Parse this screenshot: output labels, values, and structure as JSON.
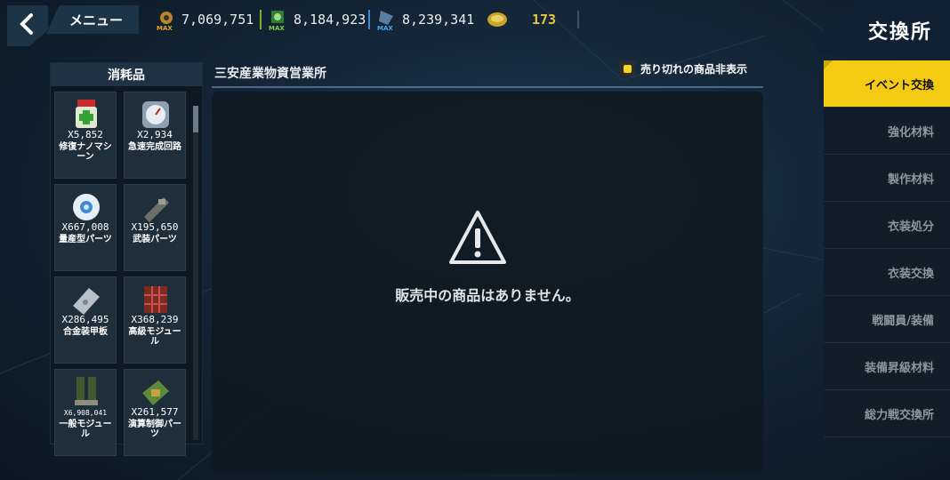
{
  "header": {
    "menu_label": "メニュー",
    "title": "交換所",
    "resources": [
      {
        "icon": "gear-max-icon",
        "value": "7,069,751",
        "badge": "MAX"
      },
      {
        "icon": "green-max-icon",
        "value": "8,184,923",
        "badge": "MAX"
      },
      {
        "icon": "blue-max-icon",
        "value": "8,239,341",
        "badge": "MAX"
      },
      {
        "icon": "gold-coin-icon",
        "value": "173"
      }
    ],
    "colors": {
      "accent": "#f4cb12"
    }
  },
  "inventory": {
    "heading": "消耗品",
    "items": [
      {
        "icon": "repair-nanomachine-icon",
        "count": "X5,852",
        "name": "修復ナノマシーン"
      },
      {
        "icon": "quick-circuit-icon",
        "count": "X2,934",
        "name": "急速完成回路"
      },
      {
        "icon": "mass-production-parts-icon",
        "count": "X667,008",
        "name": "量産型パーツ"
      },
      {
        "icon": "weapon-parts-icon",
        "count": "X195,650",
        "name": "武装パーツ"
      },
      {
        "icon": "alloy-armor-icon",
        "count": "X286,495",
        "name": "合金装甲板"
      },
      {
        "icon": "advanced-module-icon",
        "count": "X368,239",
        "name": "高級モジュール"
      },
      {
        "icon": "general-module-icon",
        "count": "X6,908,041",
        "name": "一般モジュール"
      },
      {
        "icon": "control-parts-icon",
        "count": "X261,577",
        "name": "演算制御パーツ"
      }
    ]
  },
  "shop": {
    "title": "三安産業物資営業所",
    "hide_soldout_label": "売り切れの商品非表示",
    "empty_message": "販売中の商品はありません。"
  },
  "tabs": [
    {
      "label": "イベント交換",
      "active": true
    },
    {
      "label": "強化材料"
    },
    {
      "label": "製作材料"
    },
    {
      "label": "衣装処分"
    },
    {
      "label": "衣装交換"
    },
    {
      "label": "戦闘員/装備"
    },
    {
      "label": "装備昇級材料"
    },
    {
      "label": "総力戦交換所"
    }
  ]
}
